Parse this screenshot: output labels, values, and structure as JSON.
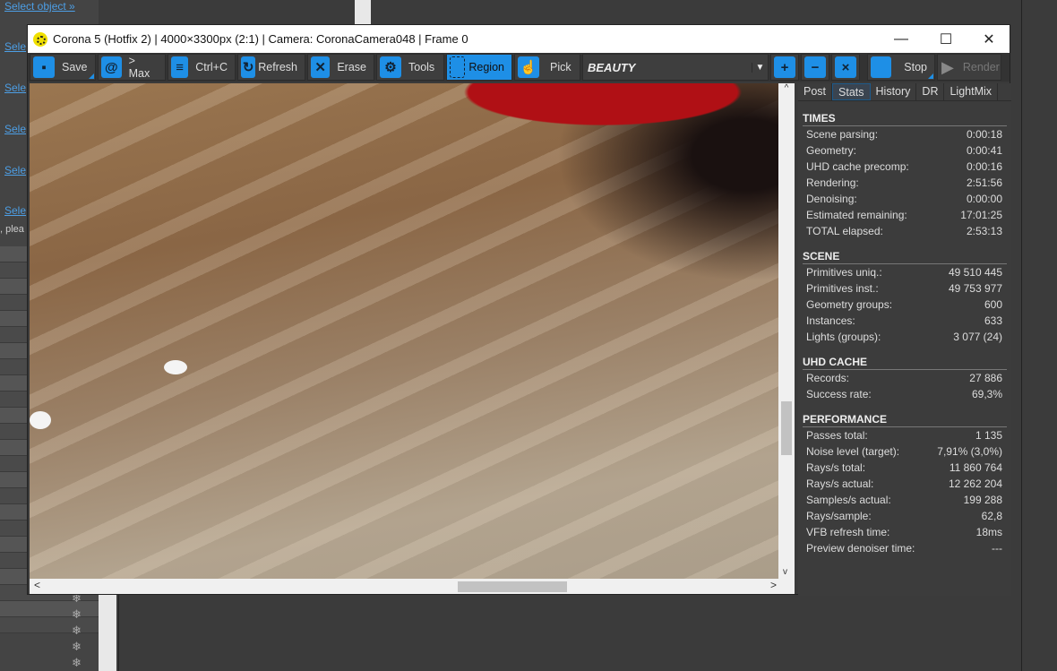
{
  "background": {
    "select_object": "Select object »",
    "select_short": "Sele",
    "plea": ", plea",
    "snowflake": "❄"
  },
  "window": {
    "title": "Corona 5 (Hotfix 2) | 4000×3300px (2:1) | Camera: CoronaCamera048 | Frame 0",
    "minimize": "—",
    "maximize": "☐",
    "close": "✕"
  },
  "toolbar": {
    "save": "Save",
    "max": "> Max",
    "copy": "Ctrl+C",
    "refresh": "Refresh",
    "erase": "Erase",
    "tools": "Tools",
    "region": "Region",
    "pick": "Pick",
    "channel": "BEAUTY",
    "stop": "Stop",
    "render": "Render"
  },
  "tabs": [
    "Post",
    "Stats",
    "History",
    "DR",
    "LightMix"
  ],
  "active_tab": "Stats",
  "stats": [
    {
      "title": "TIMES",
      "rows": [
        [
          "Scene parsing:",
          "0:00:18"
        ],
        [
          "Geometry:",
          "0:00:41"
        ],
        [
          "UHD cache precomp:",
          "0:00:16"
        ],
        [
          "Rendering:",
          "2:51:56"
        ],
        [
          "Denoising:",
          "0:00:00"
        ],
        [
          "Estimated remaining:",
          "17:01:25"
        ],
        [
          "TOTAL elapsed:",
          "2:53:13"
        ]
      ]
    },
    {
      "title": "SCENE",
      "rows": [
        [
          "Primitives uniq.:",
          "49 510 445"
        ],
        [
          "Primitives inst.:",
          "49 753 977"
        ],
        [
          "Geometry groups:",
          "600"
        ],
        [
          "Instances:",
          "633"
        ],
        [
          "Lights (groups):",
          "3 077 (24)"
        ]
      ]
    },
    {
      "title": "UHD CACHE",
      "rows": [
        [
          "Records:",
          "27 886"
        ],
        [
          "Success rate:",
          "69,3%"
        ]
      ]
    },
    {
      "title": "PERFORMANCE",
      "rows": [
        [
          "Passes total:",
          "1 135"
        ],
        [
          "Noise level (target):",
          "7,91% (3,0%)"
        ],
        [
          "Rays/s total:",
          "11 860 764"
        ],
        [
          "Rays/s actual:",
          "12 262 204"
        ],
        [
          "Samples/s actual:",
          "199 288"
        ],
        [
          "Rays/sample:",
          "62,8"
        ],
        [
          "VFB refresh time:",
          "18ms"
        ],
        [
          "Preview denoiser time:",
          "---"
        ]
      ]
    }
  ]
}
